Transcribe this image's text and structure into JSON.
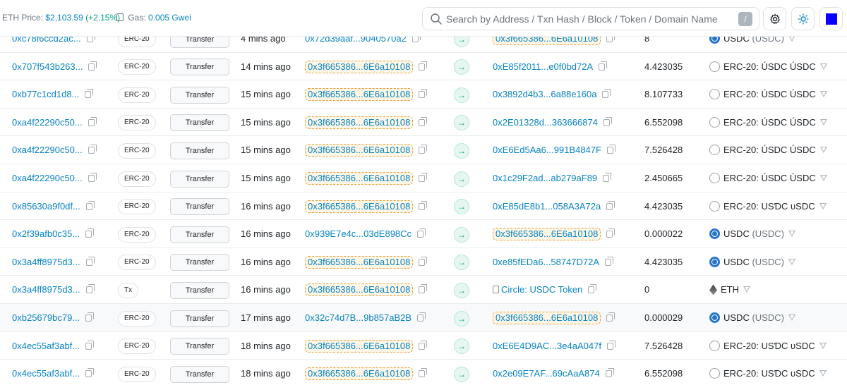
{
  "header": {
    "eth_price_label": "ETH Price:",
    "eth_price_value": "$2,103.59",
    "eth_price_change": "(+2.15%)",
    "gas_label": "Gas:",
    "gas_value": "0.005 Gwei",
    "search_placeholder": "Search by Address / Txn Hash / Block / Token / Domain Name",
    "search_shortcut": "/",
    "network_color": "#0a00ff"
  },
  "colors": {
    "link": "#0784c3",
    "positive": "#00a186",
    "highlight_border": "#e3a23b"
  },
  "rows": [
    {
      "hash": "0xc78f6ccd2ac...",
      "method": "ERC-20",
      "type": "Transfer",
      "age": "4 mins ago",
      "from": "0x72d39aaf...9040570a2",
      "from_hl": false,
      "direction": "→",
      "to": "0x3f665386...6E6a10108",
      "to_hl": true,
      "to_contract": false,
      "amount": "8",
      "token_icon": "usdc",
      "token_name": "USDC",
      "token_symbol": "(USDC)"
    },
    {
      "hash": "0x707f543b263...",
      "method": "ERC-20",
      "type": "Transfer",
      "age": "14 mins ago",
      "from": "0x3f665386...6E6a10108",
      "from_hl": true,
      "direction": "→",
      "to": "0xE85f2011...e0f0bd72A",
      "to_hl": false,
      "to_contract": false,
      "amount": "4.423035",
      "token_icon": "generic",
      "token_name": "ERC-20: ÚSDC ÚSDC",
      "token_symbol": ""
    },
    {
      "hash": "0xb77c1cd1d8...",
      "method": "ERC-20",
      "type": "Transfer",
      "age": "15 mins ago",
      "from": "0x3f665386...6E6a10108",
      "from_hl": true,
      "direction": "→",
      "to": "0x3892d4b3...6a88e160a",
      "to_hl": false,
      "to_contract": false,
      "amount": "8.107733",
      "token_icon": "generic",
      "token_name": "ERC-20: ÚSDC ÚSDC",
      "token_symbol": ""
    },
    {
      "hash": "0xa4f22290c50...",
      "method": "ERC-20",
      "type": "Transfer",
      "age": "15 mins ago",
      "from": "0x3f665386...6E6a10108",
      "from_hl": true,
      "direction": "→",
      "to": "0x2E01328d...363666874",
      "to_hl": false,
      "to_contract": false,
      "amount": "6.552098",
      "token_icon": "generic",
      "token_name": "ERC-20: ÚSDC ÚSDC",
      "token_symbol": ""
    },
    {
      "hash": "0xa4f22290c50...",
      "method": "ERC-20",
      "type": "Transfer",
      "age": "15 mins ago",
      "from": "0x3f665386...6E6a10108",
      "from_hl": true,
      "direction": "→",
      "to": "0xE6Ed5Aa6...991B4847F",
      "to_hl": false,
      "to_contract": false,
      "amount": "7.526428",
      "token_icon": "generic",
      "token_name": "ERC-20: ÚSDC ÚSDC",
      "token_symbol": ""
    },
    {
      "hash": "0xa4f22290c50...",
      "method": "ERC-20",
      "type": "Transfer",
      "age": "15 mins ago",
      "from": "0x3f665386...6E6a10108",
      "from_hl": true,
      "direction": "→",
      "to": "0x1c29F2ad...ab279aF89",
      "to_hl": false,
      "to_contract": false,
      "amount": "2.450665",
      "token_icon": "generic",
      "token_name": "ERC-20: ÚSDC ÚSDC",
      "token_symbol": ""
    },
    {
      "hash": "0x85630a9f0df...",
      "method": "ERC-20",
      "type": "Transfer",
      "age": "16 mins ago",
      "from": "0x3f665386...6E6a10108",
      "from_hl": true,
      "direction": "→",
      "to": "0xE85dE8b1...058A3A72a",
      "to_hl": false,
      "to_contract": false,
      "amount": "4.423035",
      "token_icon": "generic",
      "token_name": "ERC-20: USƊC ᴜSDC",
      "token_symbol": ""
    },
    {
      "hash": "0x2f39afb0c35...",
      "method": "ERC-20",
      "type": "Transfer",
      "age": "16 mins ago",
      "from": "0x939E7e4c...03dE898Cc",
      "from_hl": false,
      "direction": "→",
      "to": "0x3f665386...6E6a10108",
      "to_hl": true,
      "to_contract": false,
      "amount": "0.000022",
      "token_icon": "usdc",
      "token_name": "USDC",
      "token_symbol": "(USDC)"
    },
    {
      "hash": "0x3a4ff8975d3...",
      "method": "ERC-20",
      "type": "Transfer",
      "age": "16 mins ago",
      "from": "0x3f665386...6E6a10108",
      "from_hl": true,
      "direction": "→",
      "to": "0xe85fEDa6...58747D72A",
      "to_hl": false,
      "to_contract": false,
      "amount": "4.423035",
      "token_icon": "usdc",
      "token_name": "USDC",
      "token_symbol": "(USDC)"
    },
    {
      "hash": "0x3a4ff8975d3...",
      "method": "Tx",
      "type": "Transfer",
      "age": "16 mins ago",
      "from": "0x3f665386...6E6a10108",
      "from_hl": true,
      "direction": "→",
      "to": "Circle: USDC Token",
      "to_hl": false,
      "to_contract": true,
      "amount": "0",
      "token_icon": "eth",
      "token_name": "ETH",
      "token_symbol": ""
    },
    {
      "hash": "0xb25679bc79...",
      "method": "ERC-20",
      "type": "Transfer",
      "age": "17 mins ago",
      "from": "0x32c74d7B...9b857aB2B",
      "from_hl": false,
      "direction": "→",
      "to": "0x3f665386...6E6a10108",
      "to_hl": true,
      "to_contract": false,
      "amount": "0.000029",
      "token_icon": "usdc",
      "token_name": "USDC",
      "token_symbol": "(USDC)",
      "highlighted": true
    },
    {
      "hash": "0x4ec55af3abf...",
      "method": "ERC-20",
      "type": "Transfer",
      "age": "18 mins ago",
      "from": "0x3f665386...6E6a10108",
      "from_hl": true,
      "direction": "→",
      "to": "0xE6E4D9AC...3e4aA047f",
      "to_hl": false,
      "to_contract": false,
      "amount": "7.526428",
      "token_icon": "generic",
      "token_name": "ERC-20: USƊC ᴜSDC",
      "token_symbol": ""
    },
    {
      "hash": "0x4ec55af3abf...",
      "method": "ERC-20",
      "type": "Transfer",
      "age": "18 mins ago",
      "from": "0x3f665386...6E6a10108",
      "from_hl": true,
      "direction": "→",
      "to": "0x2e09E7AF...69cAaA874",
      "to_hl": false,
      "to_contract": false,
      "amount": "6.552098",
      "token_icon": "generic",
      "token_name": "ERC-20: USƊC ᴜSDC",
      "token_symbol": ""
    }
  ]
}
